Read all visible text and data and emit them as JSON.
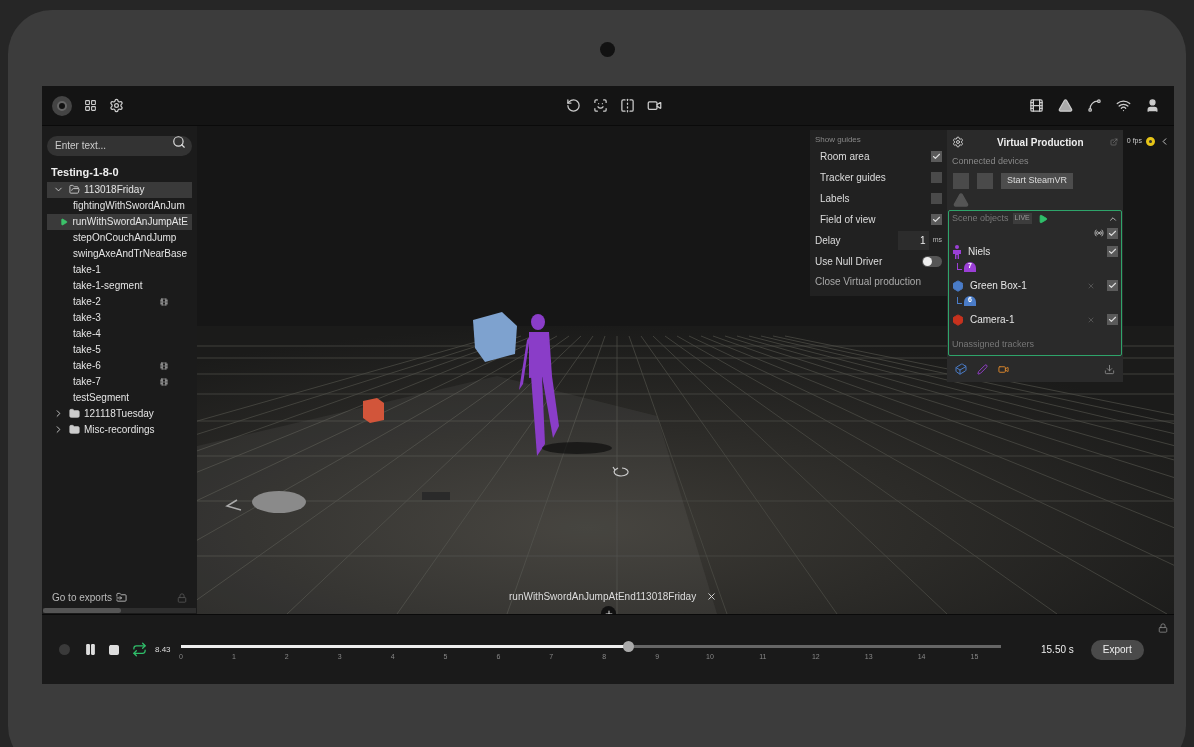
{
  "sidebar": {
    "search": {
      "placeholder": "Enter text..."
    },
    "project": "Testing-1-8-0",
    "tree": [
      {
        "label": "113018Friday",
        "kind": "folder",
        "expanded": true,
        "selected": true,
        "children": [
          {
            "label": "fightingWithSwordAnJum",
            "kind": "take",
            "selected": false,
            "playing": false,
            "video": false
          },
          {
            "label": "runWithSwordAnJumpAtE",
            "kind": "take",
            "selected": true,
            "playing": true,
            "video": false
          },
          {
            "label": "stepOnCouchAndJump",
            "kind": "take",
            "selected": false,
            "playing": false,
            "video": false
          },
          {
            "label": "swingAxeAndTrNearBase",
            "kind": "take",
            "selected": false,
            "playing": false,
            "video": false
          },
          {
            "label": "take-1",
            "kind": "take",
            "selected": false,
            "playing": false,
            "video": false
          },
          {
            "label": "take-1-segment",
            "kind": "take",
            "selected": false,
            "playing": false,
            "video": false
          },
          {
            "label": "take-2",
            "kind": "take",
            "selected": false,
            "playing": false,
            "video": true
          },
          {
            "label": "take-3",
            "kind": "take",
            "selected": false,
            "playing": false,
            "video": false
          },
          {
            "label": "take-4",
            "kind": "take",
            "selected": false,
            "playing": false,
            "video": false
          },
          {
            "label": "take-5",
            "kind": "take",
            "selected": false,
            "playing": false,
            "video": false
          },
          {
            "label": "take-6",
            "kind": "take",
            "selected": false,
            "playing": false,
            "video": true
          },
          {
            "label": "take-7",
            "kind": "take",
            "selected": false,
            "playing": false,
            "video": true
          },
          {
            "label": "testSegment",
            "kind": "take",
            "selected": false,
            "playing": false,
            "video": false
          }
        ]
      },
      {
        "label": "121118Tuesday",
        "kind": "folder",
        "expanded": false,
        "selected": false
      },
      {
        "label": "Misc-recordings",
        "kind": "folder",
        "expanded": false,
        "selected": false
      }
    ],
    "footer": "Go to exports"
  },
  "guides": {
    "title": "Show guides",
    "items": [
      {
        "label": "Room area",
        "checked": true
      },
      {
        "label": "Tracker guides",
        "checked": false
      },
      {
        "label": "Labels",
        "checked": false
      },
      {
        "label": "Field of view",
        "checked": true
      }
    ],
    "delay": {
      "label": "Delay",
      "value": "1",
      "unit": "ms"
    },
    "null_driver": {
      "label": "Use Null Driver",
      "on": false
    },
    "close": "Close Virtual production"
  },
  "virtual_production": {
    "title": "Virtual Production",
    "fps": "0 fps",
    "connected_label": "Connected devices",
    "start_button": "Start SteamVR",
    "scene": {
      "title": "Scene objects",
      "badge": "LIVE",
      "expanded": true,
      "all_checked": true,
      "objects": [
        {
          "name": "Niels",
          "kind": "character",
          "tracker": "7",
          "color": "#9b3fd6",
          "checked": true,
          "removable": false
        },
        {
          "name": "Green Box-1",
          "kind": "box",
          "tracker": "6",
          "color": "#4a7cc8",
          "checked": true,
          "removable": true
        },
        {
          "name": "Camera-1",
          "kind": "camera",
          "color": "#c8321e",
          "checked": true,
          "removable": true
        }
      ]
    },
    "unassigned": "Unassigned trackers"
  },
  "viewport": {
    "clip": "runWithSwordAnJumpAtEnd113018Friday"
  },
  "timeline": {
    "time": "8.43",
    "level": 0.545,
    "loop": true,
    "ticks": [
      "0",
      "1",
      "2",
      "3",
      "4",
      "5",
      "6",
      "7",
      "8",
      "9",
      "10",
      "11",
      "12",
      "13",
      "14",
      "15"
    ],
    "duration": "15.50 s",
    "export": "Export"
  }
}
